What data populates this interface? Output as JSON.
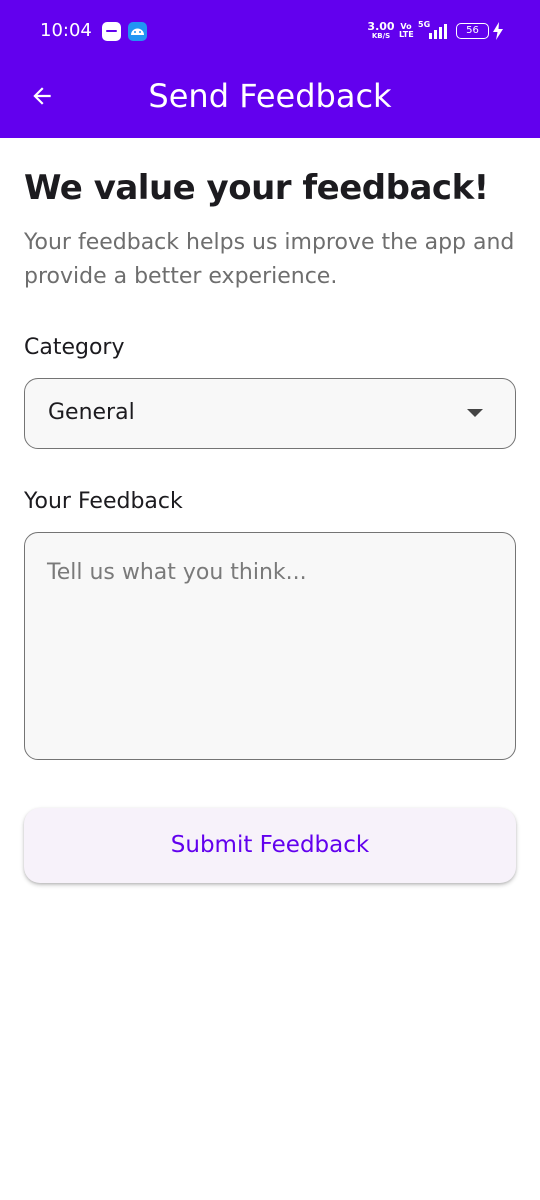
{
  "status_bar": {
    "time": "10:04",
    "network_speed_value": "3.00",
    "network_speed_unit": "KB/S",
    "volte_top": "Vo",
    "volte_bottom": "LTE",
    "network_type": "5G",
    "battery_level": "56",
    "notification_icons": [
      "app-notification-icon",
      "android-notification-icon"
    ]
  },
  "app_bar": {
    "title": "Send Feedback",
    "back_icon": "arrow-back-icon",
    "background_color": "#6200ee"
  },
  "intro": {
    "headline": "We value your feedback!",
    "description": "Your feedback helps us improve the app and provide a better experience."
  },
  "form": {
    "category": {
      "label": "Category",
      "value": "General",
      "icon": "dropdown-arrow-icon"
    },
    "feedback": {
      "label": "Your Feedback",
      "placeholder": "Tell us what you think...",
      "value": ""
    },
    "submit_label": "Submit Feedback",
    "accent_color": "#6200ee"
  }
}
